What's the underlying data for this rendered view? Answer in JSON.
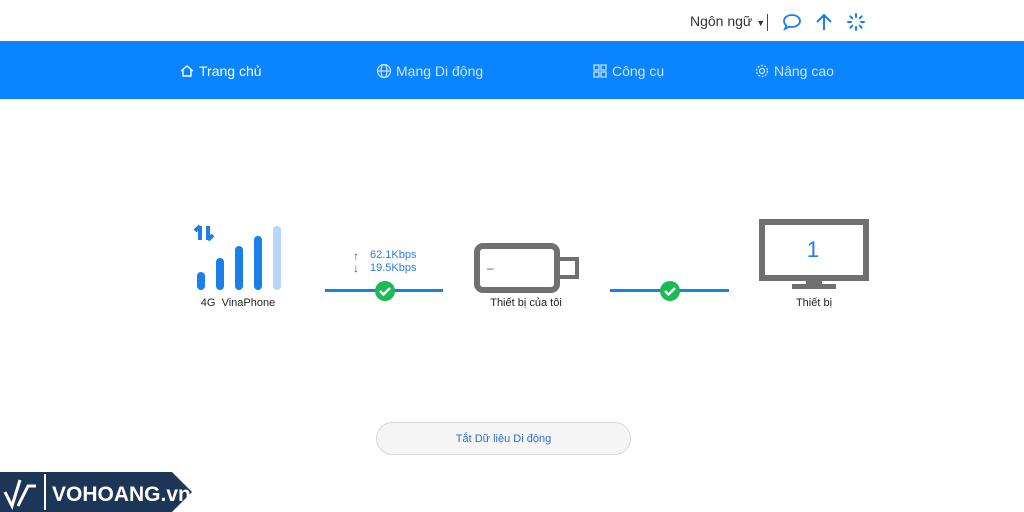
{
  "header": {
    "language_label": "Ngôn ngữ"
  },
  "nav": [
    {
      "label": "Trang chủ",
      "icon": "home-icon"
    },
    {
      "label": "Mạng Di động",
      "icon": "globe-icon"
    },
    {
      "label": "Công cụ",
      "icon": "grid-icon"
    },
    {
      "label": "Nâng cao",
      "icon": "gear-icon"
    }
  ],
  "network": {
    "type": "4G",
    "operator": "VinaPhone",
    "upload": "62.1Kbps",
    "download": "19.5Kbps",
    "signal_bars": 4,
    "signal_max": 5
  },
  "device": {
    "label": "Thiết bị của tôi",
    "battery": "–"
  },
  "clients": {
    "count": "1",
    "label": "Thiết bị"
  },
  "action": {
    "label": "Tắt Dữ liệu Di động"
  },
  "watermark": {
    "text": "VOHOANG.vn"
  },
  "colors": {
    "accent": "#0a84ff",
    "ok": "#1db954"
  }
}
